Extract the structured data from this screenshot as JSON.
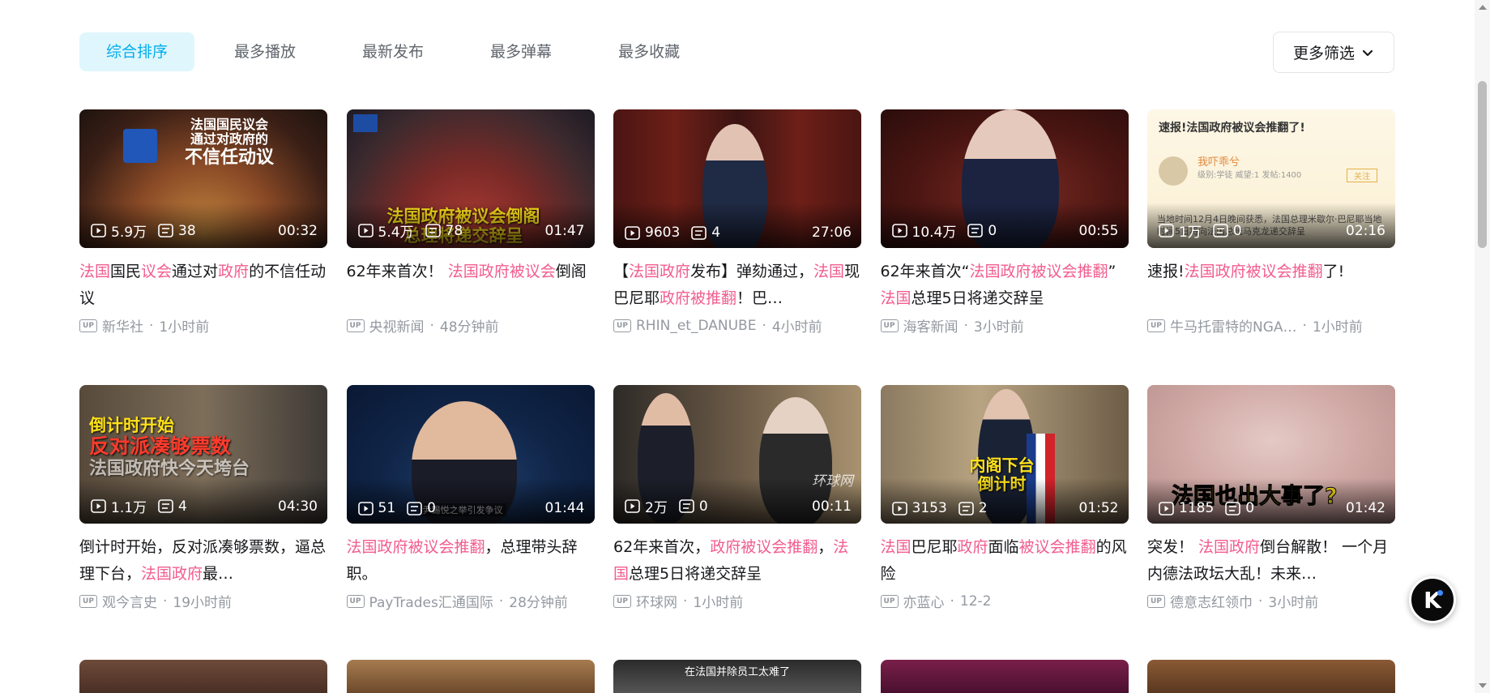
{
  "sort_tabs": [
    "综合排序",
    "最多播放",
    "最新发布",
    "最多弹幕",
    "最多收藏"
  ],
  "more_filter": "更多筛选",
  "cards": [
    {
      "views": "5.9万",
      "danmaku": "38",
      "duration": "00:32",
      "title_html": "<span class='kw'>法国</span>国民<span class='kw'>议会</span>通过对<span class='kw'>政府</span>的不信任动议",
      "author": "新华社",
      "time": "1小时前",
      "overlay": [
        "法国国民议会",
        "通过对政府的",
        "不信任动议"
      ]
    },
    {
      "views": "5.4万",
      "danmaku": "78",
      "duration": "01:47",
      "title_html": "62年来首次！ <span class='kw'>法国政府被议会</span>倒阁",
      "author": "央视新闻",
      "time": "48分钟前",
      "overlay": [
        "法国政府被议会倒阁",
        "总理将递交辞呈"
      ]
    },
    {
      "views": "9603",
      "danmaku": "4",
      "duration": "27:06",
      "title_html": "【<span class='kw'>法国政府</span>发布】弹劾通过，<span class='kw'>法国</span>现巴尼耶<span class='kw'>政府被推翻</span>！巴…",
      "author": "RHIN_et_DANUBE",
      "time": "4小时前",
      "overlay": []
    },
    {
      "views": "10.4万",
      "danmaku": "0",
      "duration": "00:55",
      "title_html": "62年来首次“<span class='kw'>法国政府被议会推翻</span>” <span class='kw'>法国</span>总理5日将递交辞呈",
      "author": "海客新闻",
      "time": "3小时前",
      "overlay": []
    },
    {
      "views": "1万",
      "danmaku": "0",
      "duration": "02:16",
      "title_html": "速报!<span class='kw'>法国政府被议会推翻</span>了!",
      "author": "牛马托雷特的NGA…",
      "time": "1小时前",
      "overlay": [
        "速报!法国政府被议会推翻了!"
      ],
      "post_user": "我吓乖兮",
      "post_meta": "级别:学徒 威望:1 发帖:1400",
      "post_follow": "关注",
      "post_body": "当地时间12月4日晚间获悉，法国总理米歇尔·巴尼耶当地时间5日将向法国总统马克龙递交辞呈"
    },
    {
      "views": "1.1万",
      "danmaku": "4",
      "duration": "04:30",
      "title_html": "倒计时开始，反对派凑够票数，逼总理下台，<span class='kw'>法国政府</span>最…",
      "author": "观今言史",
      "time": "19小时前",
      "overlay": [
        "倒计时开始",
        "反对派凑够票数",
        "法国政府快今天垮台"
      ]
    },
    {
      "views": "51",
      "danmaku": "0",
      "duration": "01:44",
      "title_html": "<span class='kw'>法国政府被议会推翻</span>，总理带头辞职。",
      "author": "PayTrades汇通国际",
      "time": "28分钟前",
      "overlay": [
        "尹锡悦之举引发争议"
      ]
    },
    {
      "views": "2万",
      "danmaku": "0",
      "duration": "00:11",
      "title_html": "62年来首次，<span class='kw'>政府被议会推翻</span>，<span class='kw'>法国</span>总理5日将递交辞呈",
      "author": "环球网",
      "time": "1小时前",
      "overlay": [
        "环球网"
      ]
    },
    {
      "views": "3153",
      "danmaku": "2",
      "duration": "01:52",
      "title_html": "<span class='kw'>法国</span>巴尼耶<span class='kw'>政府</span>面临<span class='kw'>被议会推翻</span>的风险",
      "author": "亦蓝心",
      "time": "12-2",
      "overlay": [
        "内阁下台",
        "倒计时"
      ]
    },
    {
      "views": "1185",
      "danmaku": "0",
      "duration": "01:42",
      "title_html": "突发！ <span class='kw'>法国政府</span>倒台解散！ 一个月内德法政坛大乱！未来…",
      "author": "德意志红领巾",
      "time": "3小时前",
      "overlay": [
        "法国也出大事了?"
      ]
    }
  ],
  "row3_caption": "在法国并除员工太难了"
}
